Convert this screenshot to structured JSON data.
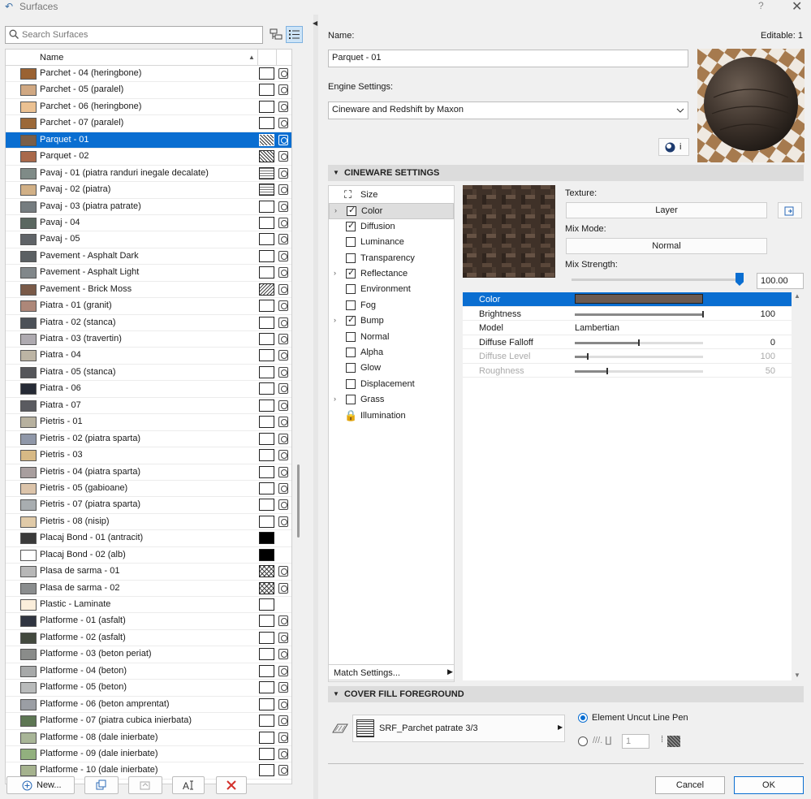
{
  "window": {
    "title": "Surfaces",
    "help": "?",
    "close": "✕"
  },
  "search": {
    "placeholder": "Search Surfaces"
  },
  "list": {
    "header": "Name",
    "rows": [
      {
        "name": "Parchet - 04 (heringbone)",
        "color": "#9a6232",
        "box": "",
        "pic": true
      },
      {
        "name": "Parchet - 05 (paralel)",
        "color": "#d0a882",
        "box": "",
        "pic": true
      },
      {
        "name": "Parchet - 06 (heringbone)",
        "color": "#ebc192",
        "box": "",
        "pic": true
      },
      {
        "name": "Parchet - 07 (paralel)",
        "color": "#9b6838",
        "box": "",
        "pic": true
      },
      {
        "name": "Parquet - 01",
        "color": "#7a5e48",
        "box": "b-dots",
        "pic": true,
        "selected": true
      },
      {
        "name": "Parquet - 02",
        "color": "#a9694b",
        "box": "b-dots",
        "pic": true
      },
      {
        "name": "Pavaj - 01 (piatra randuri inegale decalate)",
        "color": "#7f8b87",
        "box": "b-grid",
        "pic": true
      },
      {
        "name": "Pavaj - 02 (piatra)",
        "color": "#d1b086",
        "box": "b-grid",
        "pic": true
      },
      {
        "name": "Pavaj - 03 (piatra patrate)",
        "color": "#767d80",
        "box": "",
        "pic": true
      },
      {
        "name": "Pavaj - 04",
        "color": "#5b6760",
        "box": "",
        "pic": true
      },
      {
        "name": "Pavaj - 05",
        "color": "#5f6367",
        "box": "",
        "pic": true
      },
      {
        "name": "Pavement - Asphalt Dark",
        "color": "#5b6063",
        "box": "",
        "pic": true
      },
      {
        "name": "Pavement - Asphalt Light",
        "color": "#81878a",
        "box": "",
        "pic": true
      },
      {
        "name": "Pavement - Brick Moss",
        "color": "#7a5a48",
        "box": "b-hatch",
        "pic": true
      },
      {
        "name": "Piatra - 01 (granit)",
        "color": "#ad8779",
        "box": "",
        "pic": true
      },
      {
        "name": "Piatra - 02 (stanca)",
        "color": "#4c5158",
        "box": "",
        "pic": true
      },
      {
        "name": "Piatra - 03 (travertin)",
        "color": "#aeaab0",
        "box": "",
        "pic": true
      },
      {
        "name": "Piatra - 04",
        "color": "#bcb4a4",
        "box": "",
        "pic": true
      },
      {
        "name": "Piatra - 05 (stanca)",
        "color": "#55565a",
        "box": "",
        "pic": true
      },
      {
        "name": "Piatra - 06",
        "color": "#262b36",
        "box": "",
        "pic": true
      },
      {
        "name": "Piatra - 07",
        "color": "#5a5b60",
        "box": "",
        "pic": true
      },
      {
        "name": "Pietris - 01",
        "color": "#b7b19f",
        "box": "",
        "pic": true
      },
      {
        "name": "Pietris - 02 (piatra sparta)",
        "color": "#8f97a8",
        "box": "",
        "pic": true
      },
      {
        "name": "Pietris - 03",
        "color": "#d7b985",
        "box": "",
        "pic": true
      },
      {
        "name": "Pietris - 04 (piatra sparta)",
        "color": "#a89e9e",
        "box": "",
        "pic": true
      },
      {
        "name": "Pietris - 05 (gabioane)",
        "color": "#dcc4aa",
        "box": "",
        "pic": true
      },
      {
        "name": "Pietris - 07 (piatra sparta)",
        "color": "#a8adb0",
        "box": "",
        "pic": true
      },
      {
        "name": "Pietris - 08 (nisip)",
        "color": "#e0caa8",
        "box": "",
        "pic": true
      },
      {
        "name": "Placaj Bond - 01 (antracit)",
        "color": "#3a3a3a",
        "box": "b-solid",
        "pic": false
      },
      {
        "name": "Placaj Bond - 02 (alb)",
        "color": "#ffffff",
        "box": "b-solid",
        "pic": false
      },
      {
        "name": "Plasa de sarma - 01",
        "color": "#b7b7b7",
        "box": "b-mesh",
        "pic": true
      },
      {
        "name": "Plasa de sarma - 02",
        "color": "#8a8d8e",
        "box": "b-mesh",
        "pic": true
      },
      {
        "name": "Plastic - Laminate",
        "color": "#fbeedb",
        "box": "",
        "pic": false
      },
      {
        "name": "Platforme - 01 (asfalt)",
        "color": "#2f3440",
        "box": "",
        "pic": true
      },
      {
        "name": "Platforme - 02 (asfalt)",
        "color": "#43493e",
        "box": "",
        "pic": true
      },
      {
        "name": "Platforme - 03 (beton periat)",
        "color": "#8a8c8a",
        "box": "",
        "pic": true
      },
      {
        "name": "Platforme - 04 (beton)",
        "color": "#a7a9a9",
        "box": "",
        "pic": true
      },
      {
        "name": "Platforme - 05 (beton)",
        "color": "#b9bbbb",
        "box": "",
        "pic": true
      },
      {
        "name": "Platforme - 06 (beton amprentat)",
        "color": "#9b9ea4",
        "box": "",
        "pic": true
      },
      {
        "name": "Platforme - 07 (piatra cubica inierbata)",
        "color": "#5d7653",
        "box": "",
        "pic": true
      },
      {
        "name": "Platforme - 08 (dale inierbate)",
        "color": "#a8b597",
        "box": "",
        "pic": true
      },
      {
        "name": "Platforme - 09 (dale inierbate)",
        "color": "#92b07e",
        "box": "",
        "pic": true
      },
      {
        "name": "Platforme - 10 (dale inierbate)",
        "color": "#a5b28e",
        "box": "",
        "pic": true
      }
    ]
  },
  "bottom": {
    "new_label": "New..."
  },
  "right": {
    "name_label": "Name:",
    "editable_label": "Editable: 1",
    "name_value": "Parquet - 01",
    "engine_label": "Engine Settings:",
    "engine_value": "Cineware and Redshift by Maxon",
    "info_btn": "i",
    "section_cineware": "CINEWARE SETTINGS",
    "channels": [
      {
        "label": "Size",
        "type": "icon",
        "icon": "⛶"
      },
      {
        "label": "Color",
        "type": "check",
        "on": true,
        "expand": true,
        "hl": true
      },
      {
        "label": "Diffusion",
        "type": "check",
        "on": true
      },
      {
        "label": "Luminance",
        "type": "check",
        "on": false
      },
      {
        "label": "Transparency",
        "type": "check",
        "on": false
      },
      {
        "label": "Reflectance",
        "type": "check",
        "on": true,
        "expand": true
      },
      {
        "label": "Environment",
        "type": "check",
        "on": false
      },
      {
        "label": "Fog",
        "type": "check",
        "on": false
      },
      {
        "label": "Bump",
        "type": "check",
        "on": true,
        "expand": true
      },
      {
        "label": "Normal",
        "type": "check",
        "on": false
      },
      {
        "label": "Alpha",
        "type": "check",
        "on": false
      },
      {
        "label": "Glow",
        "type": "check",
        "on": false
      },
      {
        "label": "Displacement",
        "type": "check",
        "on": false
      },
      {
        "label": "Grass",
        "type": "check",
        "on": false,
        "expand": true
      },
      {
        "label": "Illumination",
        "type": "icon",
        "icon": "🔒"
      }
    ],
    "match_settings": "Match Settings...",
    "texture_label": "Texture:",
    "texture_value": "Layer",
    "mixmode_label": "Mix Mode:",
    "mixmode_value": "Normal",
    "mixstrength_label": "Mix Strength:",
    "mixstrength_value": "100.00",
    "mixstrength_fraction": 1.0,
    "props": [
      {
        "name": "Color",
        "value": "",
        "selected": true,
        "swatch": "#6b5a50"
      },
      {
        "name": "Brightness",
        "value": "100",
        "slider": 1.0
      },
      {
        "name": "Model",
        "value": "Lambertian"
      },
      {
        "name": "Diffuse Falloff",
        "value": "0",
        "slider": 0.5
      },
      {
        "name": "Diffuse Level",
        "value": "100",
        "slider": 0.1,
        "dim": true
      },
      {
        "name": "Roughness",
        "value": "50",
        "slider": 0.25,
        "dim": true
      }
    ],
    "section_cover": "COVER FILL FOREGROUND",
    "cover_fill": "SRF_Parchet patrate 3/3",
    "pen_option": "Element Uncut Line Pen",
    "pen_number": "1",
    "cancel": "Cancel",
    "ok": "OK"
  }
}
